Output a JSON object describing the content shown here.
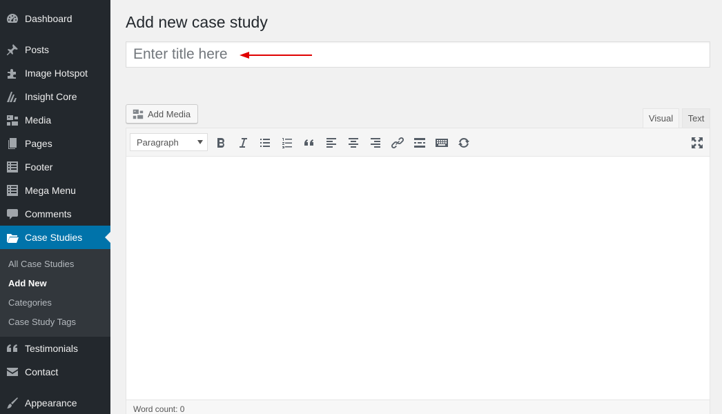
{
  "sidebar": {
    "items": [
      {
        "label": "Dashboard",
        "icon": "dashboard-icon"
      },
      {
        "label": "Posts",
        "icon": "pin-icon"
      },
      {
        "label": "Image Hotspot",
        "icon": "puzzle-icon"
      },
      {
        "label": "Insight Core",
        "icon": "insight-icon"
      },
      {
        "label": "Media",
        "icon": "media-icon"
      },
      {
        "label": "Pages",
        "icon": "pages-icon"
      },
      {
        "label": "Footer",
        "icon": "list-icon"
      },
      {
        "label": "Mega Menu",
        "icon": "list-icon"
      },
      {
        "label": "Comments",
        "icon": "comment-icon"
      },
      {
        "label": "Case Studies",
        "icon": "folder-icon"
      },
      {
        "label": "Testimonials",
        "icon": "quote-icon"
      },
      {
        "label": "Contact",
        "icon": "mail-icon"
      },
      {
        "label": "Appearance",
        "icon": "brush-icon"
      }
    ],
    "submenu": [
      {
        "label": "All Case Studies"
      },
      {
        "label": "Add New"
      },
      {
        "label": "Categories"
      },
      {
        "label": "Case Study Tags"
      }
    ]
  },
  "main": {
    "page_title": "Add new case study",
    "title_placeholder": "Enter title here",
    "add_media_label": "Add Media",
    "tabs": {
      "visual": "Visual",
      "text": "Text"
    },
    "format_select": "Paragraph",
    "word_count": "Word count: 0"
  },
  "colors": {
    "sidebar_bg": "#23282d",
    "sidebar_active": "#0073aa",
    "annotation_arrow": "#e00000"
  }
}
